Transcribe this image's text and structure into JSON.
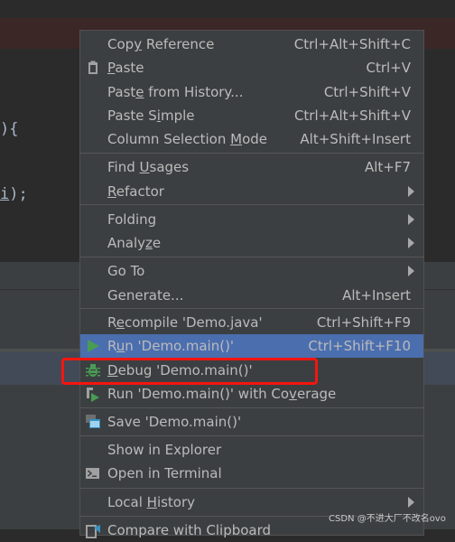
{
  "editor": {
    "code_line_1": "){",
    "code_line_2_var": "i",
    "code_line_2_tail": ");"
  },
  "menu": {
    "items": [
      {
        "label_pre": "Cop",
        "mnemonic": "y",
        "label_post": " Reference",
        "shortcut": "Ctrl+Alt+Shift+C"
      },
      {
        "label_pre": "",
        "mnemonic": "P",
        "label_post": "aste",
        "shortcut": "Ctrl+V",
        "icon": "clipboard-icon"
      },
      {
        "label_pre": "Past",
        "mnemonic": "e",
        "label_post": " from History...",
        "shortcut": "Ctrl+Shift+V"
      },
      {
        "label_pre": "Paste S",
        "mnemonic": "i",
        "label_post": "mple",
        "shortcut": "Ctrl+Alt+Shift+V"
      },
      {
        "label_pre": "Column Selection ",
        "mnemonic": "M",
        "label_post": "ode",
        "shortcut": "Alt+Shift+Insert"
      },
      {
        "label_pre": "Find ",
        "mnemonic": "U",
        "label_post": "sages",
        "shortcut": "Alt+F7"
      },
      {
        "label_pre": "",
        "mnemonic": "R",
        "label_post": "efactor",
        "submenu": true
      },
      {
        "label_pre": "Folding",
        "mnemonic": "",
        "label_post": "",
        "submenu": true
      },
      {
        "label_pre": "Analy",
        "mnemonic": "z",
        "label_post": "e",
        "submenu": true
      },
      {
        "label_pre": "Go To",
        "mnemonic": "",
        "label_post": "",
        "submenu": true
      },
      {
        "label_pre": "Generate...",
        "mnemonic": "",
        "label_post": "",
        "shortcut": "Alt+Insert"
      },
      {
        "label_pre": "R",
        "mnemonic": "e",
        "label_post": "compile 'Demo.java'",
        "shortcut": "Ctrl+Shift+F9"
      },
      {
        "label_pre": "R",
        "mnemonic": "u",
        "label_post": "n 'Demo.main()'",
        "shortcut": "Ctrl+Shift+F10",
        "icon": "run-icon",
        "highlighted": true
      },
      {
        "label_pre": "",
        "mnemonic": "D",
        "label_post": "ebug 'Demo.main()'",
        "icon": "debug-icon"
      },
      {
        "label_pre": "Run 'Demo.main()' with Co",
        "mnemonic": "v",
        "label_post": "erage",
        "icon": "coverage-icon"
      },
      {
        "label_pre": "Save 'Demo.main()'",
        "mnemonic": "",
        "label_post": "",
        "icon": "save-config-icon"
      },
      {
        "label_pre": "Show in Explorer",
        "mnemonic": "",
        "label_post": ""
      },
      {
        "label_pre": "Open in Terminal",
        "mnemonic": "",
        "label_post": "",
        "icon": "terminal-icon"
      },
      {
        "label_pre": "Local ",
        "mnemonic": "H",
        "label_post": "istory",
        "submenu": true
      },
      {
        "label_pre": "Compare with Clipboard",
        "mnemonic": "",
        "label_post": "",
        "icon": "compare-icon"
      }
    ]
  },
  "colors": {
    "menu_bg": "#3c3f41",
    "highlight": "#4b6eaf",
    "annotation": "#f5150f",
    "run_green": "#499c54"
  },
  "watermark": "CSDN @不进大厂不改名ovo"
}
